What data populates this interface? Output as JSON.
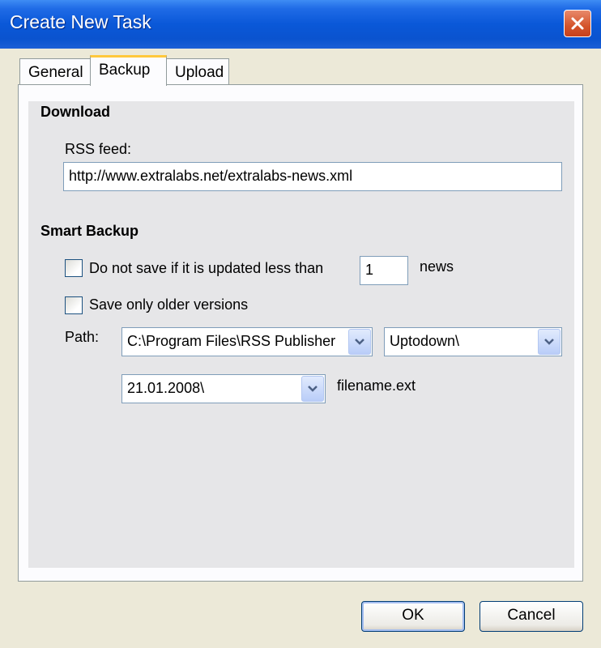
{
  "window": {
    "title": "Create New Task"
  },
  "tabs": [
    {
      "label": "General"
    },
    {
      "label": "Backup"
    },
    {
      "label": "Upload"
    }
  ],
  "download": {
    "section_title": "Download",
    "rss_label": "RSS feed:",
    "rss_value": "http://www.extralabs.net/extralabs-news.xml"
  },
  "smart_backup": {
    "section_title": "Smart Backup",
    "do_not_save_label": "Do not save if it is updated less than",
    "do_not_save_checked": false,
    "news_count": "1",
    "news_label": "news",
    "save_older_label": "Save only older versions",
    "save_older_checked": false,
    "path_label": "Path:",
    "path_combo1": "C:\\Program Files\\RSS Publisher",
    "path_combo2": "Uptodown\\",
    "path_combo3": "21.01.2008\\",
    "filename_label": "filename.ext"
  },
  "buttons": {
    "ok": "OK",
    "cancel": "Cancel"
  },
  "colors": {
    "titlebar": "#0A58D8",
    "tab_highlight": "#FFC83C",
    "panel_bg": "#E6E6E8",
    "dialog_bg": "#ECE9D8"
  },
  "icons": {
    "close": "close-icon",
    "dropdown": "chevron-down-icon"
  }
}
